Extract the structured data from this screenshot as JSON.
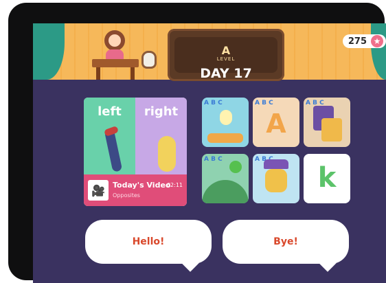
{
  "header": {
    "level_letter": "A",
    "level_label": "LEVEL",
    "day": "DAY 17",
    "stars_count": "275"
  },
  "todays_video": {
    "word_left": "left",
    "word_right": "right",
    "title": "Today's Video",
    "duration": "02:11",
    "subtitle": "Opposites"
  },
  "activity_tiles": [
    {
      "label": "A",
      "icon": "abc-icon"
    },
    {
      "label": "A",
      "icon": "abc-icon"
    },
    {
      "label": "",
      "icon": "abc-icon"
    },
    {
      "label": "",
      "icon": "abc-icon"
    },
    {
      "label": "",
      "icon": "abc-icon"
    },
    {
      "label": "k",
      "icon": "k-icon"
    }
  ],
  "greetings": {
    "hello": "Hello!",
    "bye": "Bye!"
  }
}
